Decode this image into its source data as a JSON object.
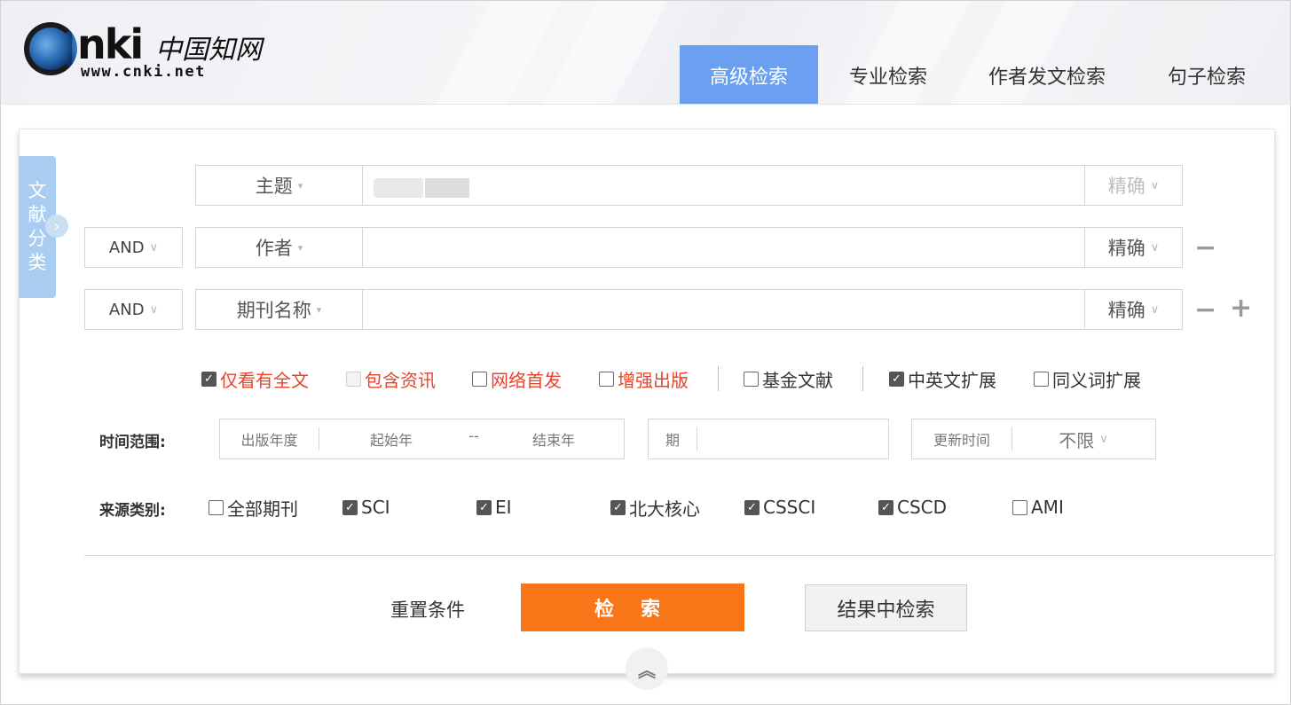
{
  "header": {
    "logo_brand": "nki",
    "logo_cn": "中国知网",
    "logo_url": "www.cnki.net",
    "tabs": [
      {
        "label": "高级检索",
        "active": true
      },
      {
        "label": "专业检索",
        "active": false
      },
      {
        "label": "作者发文检索",
        "active": false
      },
      {
        "label": "句子检索",
        "active": false
      }
    ]
  },
  "sidebar": {
    "label_chars": [
      "文",
      "献",
      "分",
      "类"
    ]
  },
  "rows": [
    {
      "logic": "",
      "field": "主题",
      "value": "",
      "match": "精确"
    },
    {
      "logic": "AND",
      "field": "作者",
      "value": "",
      "match": "精确"
    },
    {
      "logic": "AND",
      "field": "期刊名称",
      "value": "",
      "match": "精确"
    }
  ],
  "filters": [
    {
      "label": "仅看有全文",
      "checked": true,
      "style": "red"
    },
    {
      "label": "包含资讯",
      "checked": false,
      "disabled": true,
      "style": "red"
    },
    {
      "label": "网络首发",
      "checked": false,
      "style": "red"
    },
    {
      "label": "增强出版",
      "checked": false,
      "style": "red"
    },
    {
      "label": "基金文献",
      "checked": false,
      "style": "normal"
    },
    {
      "label": "中英文扩展",
      "checked": true,
      "style": "normal"
    },
    {
      "label": "同义词扩展",
      "checked": false,
      "style": "normal"
    }
  ],
  "time": {
    "label": "时间范围:",
    "year_type": "出版年度",
    "start": "起始年",
    "dash": "--",
    "end": "结束年",
    "issue_label": "期",
    "update_label": "更新时间",
    "update_value": "不限"
  },
  "source": {
    "label": "来源类别:",
    "items": [
      {
        "label": "全部期刊",
        "checked": false
      },
      {
        "label": "SCI",
        "checked": true
      },
      {
        "label": "EI",
        "checked": true
      },
      {
        "label": "北大核心",
        "checked": true
      },
      {
        "label": "CSSCI",
        "checked": true
      },
      {
        "label": "CSCD",
        "checked": true
      },
      {
        "label": "AMI",
        "checked": false
      }
    ]
  },
  "actions": {
    "reset": "重置条件",
    "search": "检 索",
    "search_within": "结果中检索"
  },
  "icons": {
    "dropdown": "caret-down-icon",
    "chevron": "chevron-down-icon",
    "remove_row": "minus-icon",
    "add_row": "plus-icon",
    "collapse": "double-chevron-up-icon",
    "sidebar_expand": "chevron-right-icon"
  },
  "colors": {
    "active_tab": "#6b9ff0",
    "search_button": "#f87618",
    "red_option": "#e8432a",
    "side_tab": "#a9cdf0"
  }
}
